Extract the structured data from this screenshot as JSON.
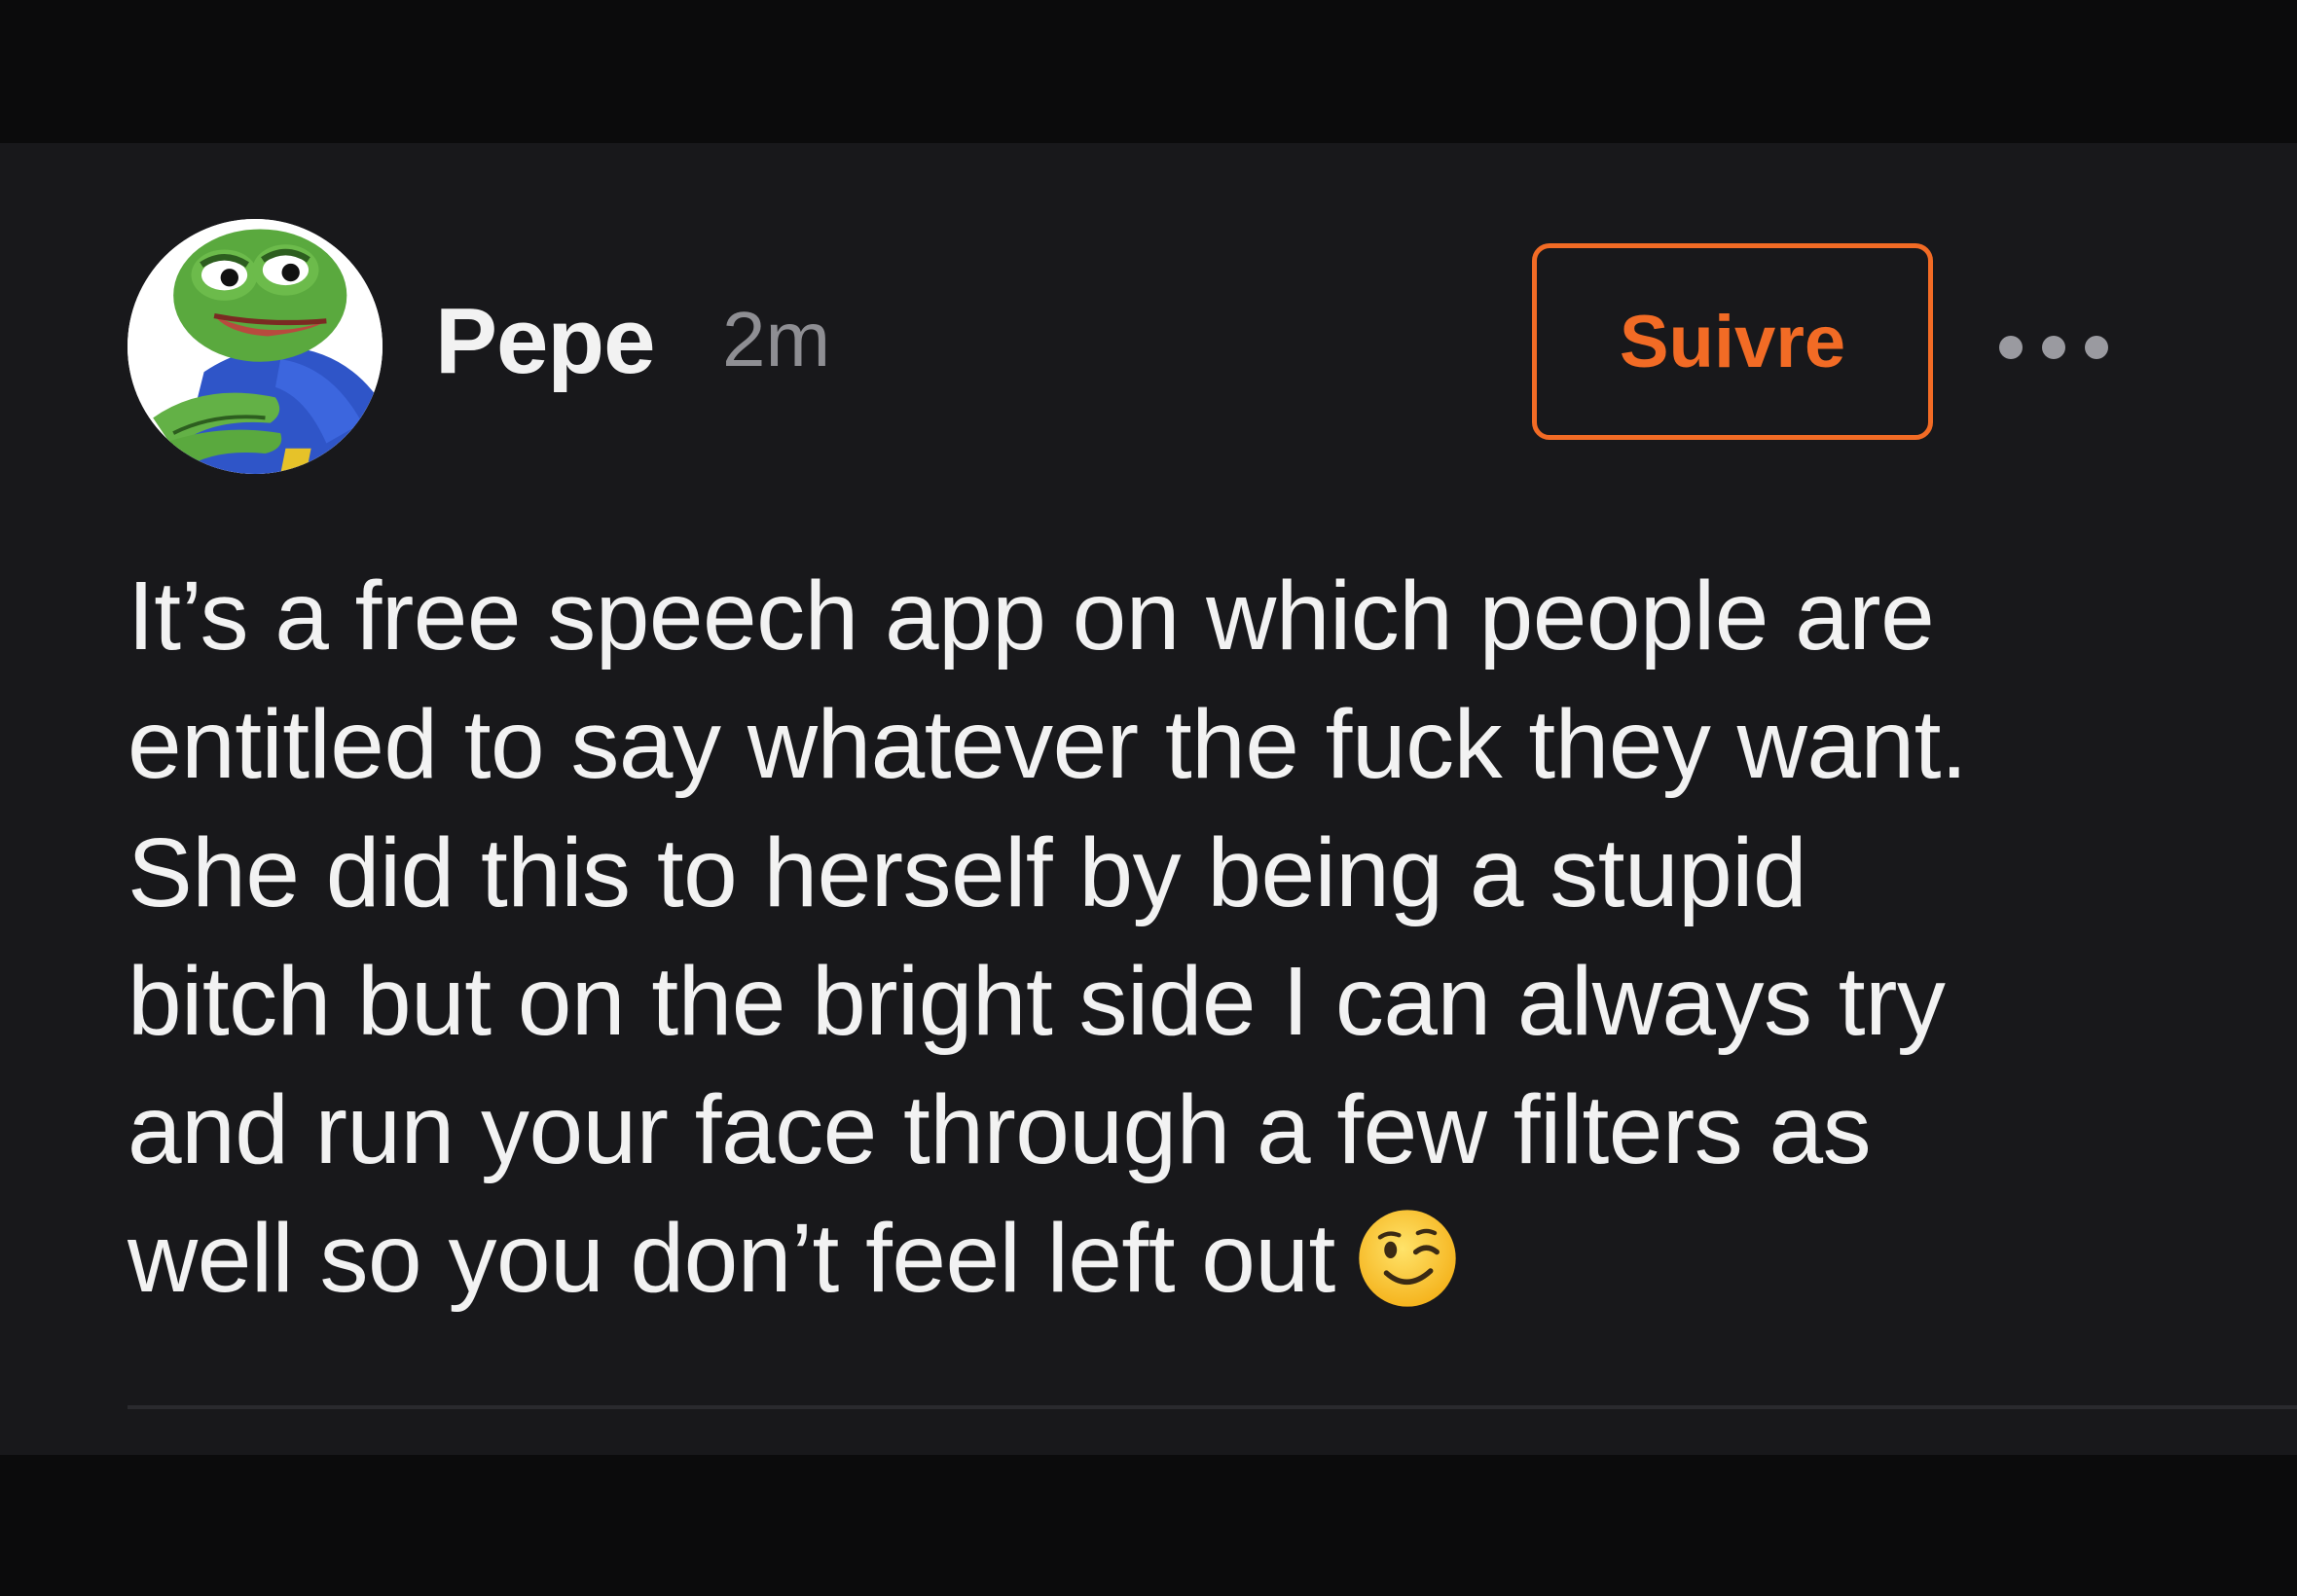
{
  "post": {
    "author": "Pepe",
    "timestamp": "2m",
    "follow_label": "Suivre",
    "more_icon": "more-horizontal-icon",
    "avatar_icon": "pepe-frog-avatar",
    "text": "It’s a free speech app on which people are\nentitled to say whatever the fuck they want.\nShe did this to herself by being a stupid\nbitch but on the bright side I can always try\nand run your face through a few filters as\nwell so you don’t feel left out",
    "emoji": "winking-face-emoji"
  },
  "colors": {
    "background": "#18181b",
    "accent": "#f26b25",
    "text_primary": "#f2f2f2",
    "text_secondary": "#8e8e93"
  }
}
